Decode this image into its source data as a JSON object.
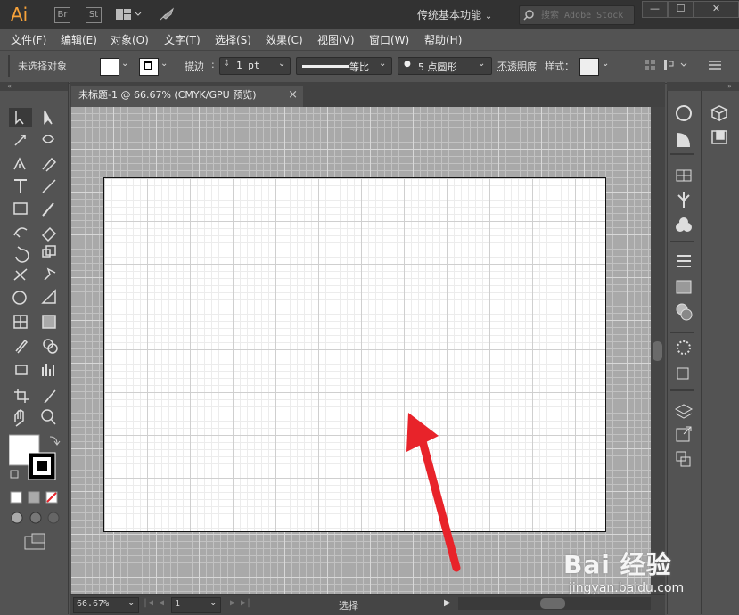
{
  "app": {
    "logo": "Ai",
    "bridge_label": "Br",
    "stock_label": "St",
    "workspace": "传统基本功能",
    "search_placeholder": "搜索 Adobe Stock"
  },
  "menu": [
    "文件(F)",
    "编辑(E)",
    "对象(O)",
    "文字(T)",
    "选择(S)",
    "效果(C)",
    "视图(V)",
    "窗口(W)",
    "帮助(H)"
  ],
  "control": {
    "selection_status": "未选择对象",
    "stroke_label": "描边",
    "stroke_weight": "1 pt",
    "stroke_profile": "等比",
    "brush_dot": "●",
    "brush": "5 点圆形",
    "opacity_label": "不透明度",
    "style_label": "样式："
  },
  "document": {
    "tab_title": "未标题-1 @ 66.67% (CMYK/GPU 预览)",
    "close_glyph": "×"
  },
  "status": {
    "zoom": "66.67%",
    "artboard_number": "1",
    "tool_name": "选择"
  },
  "annotation": {
    "arrow_color": "#e8232a"
  },
  "watermark": {
    "logo": "Bai 经验",
    "url": "jingyan.baidu.com"
  },
  "colors": {
    "accent": "#f7a23a",
    "ui_dark": "#323232",
    "ui_mid": "#535353",
    "canvas": "#a9a9a9"
  }
}
